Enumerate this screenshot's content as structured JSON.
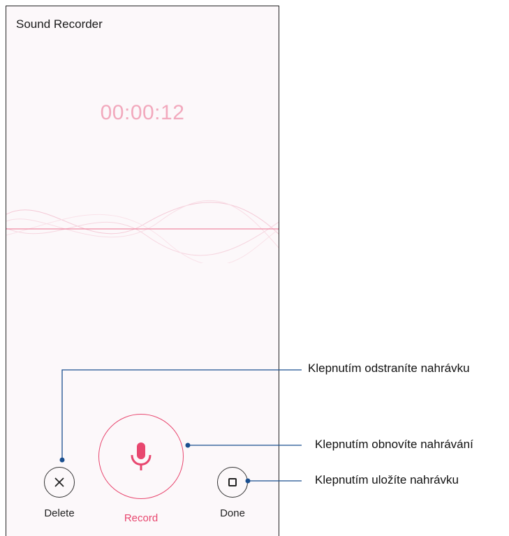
{
  "app": {
    "title": "Sound Recorder"
  },
  "timer": {
    "elapsed": "00:00:12"
  },
  "controls": {
    "delete_label": "Delete",
    "record_label": "Record",
    "done_label": "Done",
    "delete_icon": "close-icon",
    "record_icon": "microphone-icon",
    "done_icon": "stop-icon"
  },
  "callouts": {
    "delete": "Klepnutím odstraníte nahrávku",
    "record": "Klepnutím obnovíte nahrávání",
    "done": "Klepnutím uložíte nahrávku"
  },
  "colors": {
    "accent": "#e8476f",
    "timer": "#f2a9bd",
    "callout_line": "#1a4f8f"
  }
}
